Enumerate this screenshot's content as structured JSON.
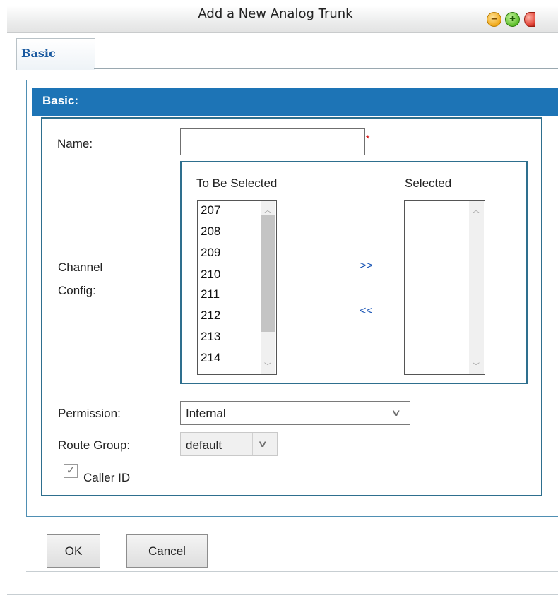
{
  "window": {
    "title": "Add a New Analog Trunk"
  },
  "tabs": [
    {
      "label": "Basic"
    }
  ],
  "section": {
    "title": "Basic:"
  },
  "form": {
    "name_label": "Name:",
    "name_value": "",
    "required_mark": "*",
    "channel_label_line1": "Channel",
    "channel_label_line2": "Config:",
    "to_be_selected_title": "To Be Selected",
    "selected_title": "Selected",
    "available_channels": [
      "207",
      "208",
      "209",
      "210",
      "211",
      "212",
      "213",
      "214"
    ],
    "selected_channels": [],
    "add_button": ">>",
    "remove_button": "<<",
    "permission_label": "Permission:",
    "permission_value": "Internal",
    "route_group_label": "Route Group:",
    "route_group_value": "default",
    "caller_id_label": "Caller ID",
    "caller_id_checked": true
  },
  "buttons": {
    "ok": "OK",
    "cancel": "Cancel"
  },
  "icons": {
    "minimize": "minimize-icon",
    "maximize": "maximize-icon",
    "close": "close-icon",
    "scroll_up": "scroll-up-icon",
    "scroll_down": "scroll-down-icon",
    "dropdown": "chevron-down-icon",
    "check": "check-icon"
  },
  "colors": {
    "section_header": "#1d74b6",
    "panel_border": "#2e6f8e",
    "tab_text": "#1a5aa0",
    "required": "#d40000",
    "move_buttons": "#1a55b5"
  }
}
